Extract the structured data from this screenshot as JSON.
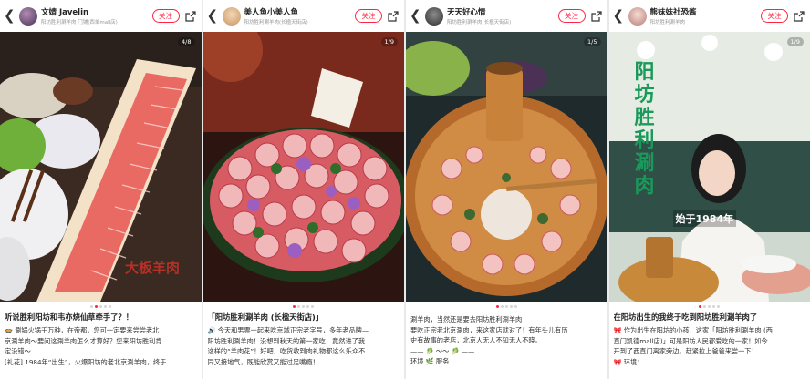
{
  "cards": [
    {
      "author": "文婧 Javelin",
      "meta": "阳坊胜利涮羊肉  门铺(西单mall店)",
      "follow": "关注",
      "page": "4/8",
      "overlay": "大板羊肉",
      "title": "听说胜利阳坊和韦亦烧仙草牵手了？！",
      "lines": [
        "🍲 涮锅火锅千万种，在帝都，您可一定要来尝尝老北",
        "京涮羊肉～要问这涮羊肉怎么才算好？您来阳坊胜利肯",
        "定没错～",
        "[礼花] 1984年“出生”，火爆阳坊的老北京涮羊肉，终于"
      ]
    },
    {
      "author": "美人鱼小美人鱼",
      "meta": "阳坊胜利涮羊肉(长楹天街店)",
      "follow": "关注",
      "page": "1/9",
      "title": "「阳坊胜利涮羊肉 (长楹天街店)」",
      "lines": [
        "🔊 今天和男票一起来吃京城正宗老字号，多年老品牌—",
        "阳坊胜利涮羊肉！没想到秋天的第一家吃，竟然进了我",
        "这样的“羊肉花”！好吧，吃货收到肉礼物都这么乐众不",
        "同又接地气，既能欣赏又能过足嘴瘾！"
      ]
    },
    {
      "author": "天天好心情",
      "meta": "阳坊胜利涮羊肉(长楹天街店)",
      "follow": "关注",
      "page": "1/5",
      "title": "涮羊肉，当然还是要去阳坊胜利涮羊肉",
      "lines": [
        "要吃正宗老北京涮肉，来这家店就对了！有年头儿有历",
        "史有故事的老店，北京人无人不知无人不晓。",
        "—— 🥬 ～～ 🥬 ——",
        "环境 🌿 服务"
      ]
    },
    {
      "author": "熊妹妹社恐酱",
      "meta": "阳坊胜利涮羊肉",
      "follow": "关注",
      "page": "1/9",
      "overlay_title": "阳坊胜利涮肉",
      "overlay_sub": "始于1984年",
      "title": "在阳坊出生的我终于吃到阳坊胜利涮羊肉了",
      "lines": [
        "🎀 作为出生在阳坊的小孩，这家「阳坊胜利涮羊肉 (西",
        "直门凯德mall店)」可是阳坊人民都爱吃的一家！如今",
        "开到了西直门离家旁边，赶紧拉上爸爸来尝一下！",
        "🎀 环境："
      ]
    }
  ],
  "colors": {
    "accent": "#ff2442"
  }
}
